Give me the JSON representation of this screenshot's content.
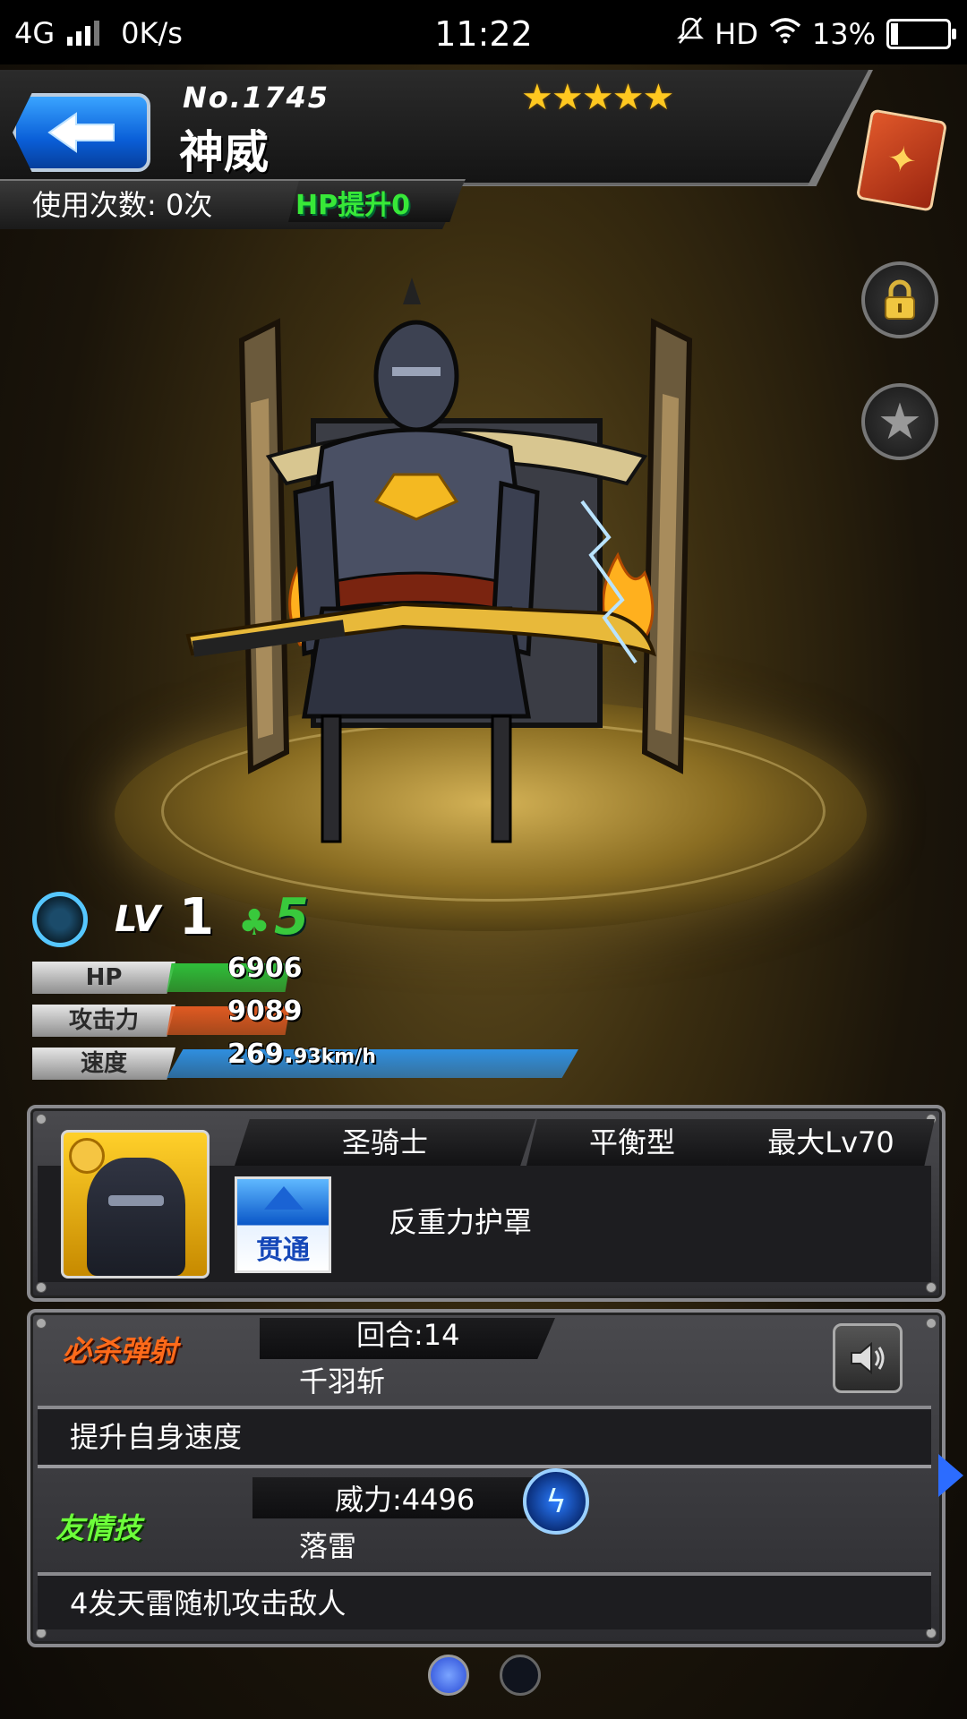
{
  "status_bar": {
    "network": "4G",
    "speed": "0K/s",
    "time": "11:22",
    "hd": "HD",
    "battery": "13%",
    "battery_level": 0.13
  },
  "header": {
    "unit_number": "No.1745",
    "unit_name": "神威",
    "rarity_stars": 5,
    "stars_text": "★★★★★",
    "usage_count": "使用次数: 0次",
    "hp_bonus": "HP提升0"
  },
  "side_buttons": {
    "book_icon": "book-icon",
    "lock_icon": "lock-icon",
    "star_icon": "star-icon"
  },
  "level": {
    "lv_label": "LV",
    "lv_value": "1",
    "luck_value": "5"
  },
  "stats": {
    "hp": {
      "label": "HP",
      "value": "6906",
      "color": "#2fbf3a",
      "fill": 0.3
    },
    "attack": {
      "label": "攻击力",
      "value": "9089",
      "color": "#e05a22",
      "fill": 0.3
    },
    "speed": {
      "label": "速度",
      "value": "269.",
      "value_small": "93km/h",
      "color": "#2f8fe0",
      "fill": 1.0
    }
  },
  "info": {
    "class": "圣骑士",
    "type": "平衡型",
    "max_level": "最大Lv70",
    "ability_badge": "贯通",
    "ability_name": "反重力护罩"
  },
  "strike_shot": {
    "title": "必杀弹射",
    "turns": "回合:14",
    "name": "千羽斩",
    "description": "提升自身速度"
  },
  "friendship": {
    "title": "友情技",
    "power": "威力:4496",
    "name": "落雷",
    "description": "4发天雷随机攻击敌人"
  },
  "pagination": {
    "total": 2,
    "active": 0
  }
}
